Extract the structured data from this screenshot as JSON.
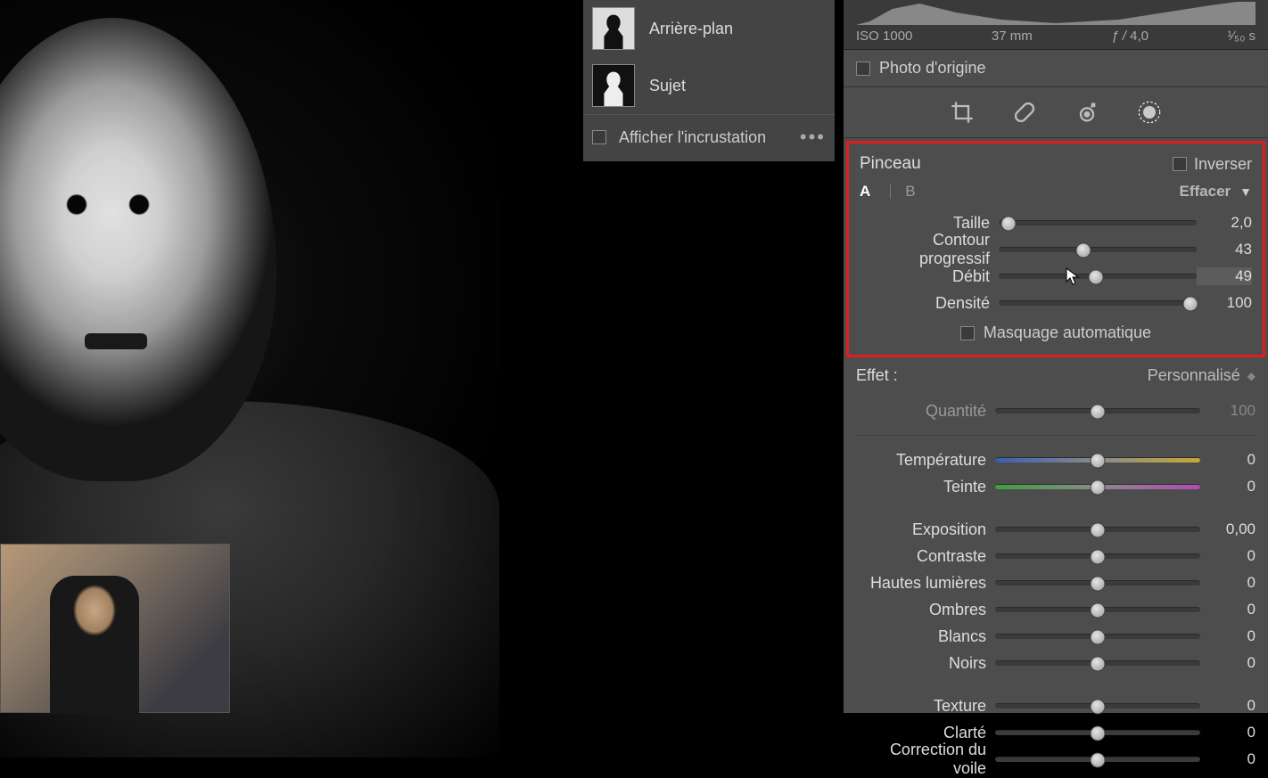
{
  "masks": {
    "background_label": "Arrière-plan",
    "subject_label": "Sujet"
  },
  "overlay": {
    "label": "Afficher l'incrustation"
  },
  "histogram": {
    "iso": "ISO 1000",
    "focal": "37 mm",
    "aperture_prefix": "ƒ / ",
    "aperture_val": "4,0",
    "shutter": "¹⁄₅₀ s"
  },
  "origin_label": "Photo d'origine",
  "brush": {
    "title": "Pinceau",
    "invert": "Inverser",
    "tab_a": "A",
    "tab_b": "B",
    "erase": "Effacer",
    "sliders": {
      "size": {
        "label": "Taille",
        "value": "2,0",
        "pos": 5
      },
      "feather": {
        "label": "Contour progressif",
        "value": "43",
        "pos": 43
      },
      "flow": {
        "label": "Débit",
        "value": "49",
        "pos": 49
      },
      "density": {
        "label": "Densité",
        "value": "100",
        "pos": 97
      }
    },
    "automask": "Masquage automatique"
  },
  "effect": {
    "label": "Effet :",
    "value": "Personnalisé"
  },
  "amount": {
    "label": "Quantité",
    "value": "100",
    "pos": 50
  },
  "adjust": {
    "temperature": {
      "label": "Température",
      "value": "0",
      "pos": 50
    },
    "tint": {
      "label": "Teinte",
      "value": "0",
      "pos": 50
    },
    "exposure": {
      "label": "Exposition",
      "value": "0,00",
      "pos": 50
    },
    "contrast": {
      "label": "Contraste",
      "value": "0",
      "pos": 50
    },
    "highlights": {
      "label": "Hautes lumières",
      "value": "0",
      "pos": 50
    },
    "shadows": {
      "label": "Ombres",
      "value": "0",
      "pos": 50
    },
    "whites": {
      "label": "Blancs",
      "value": "0",
      "pos": 50
    },
    "blacks": {
      "label": "Noirs",
      "value": "0",
      "pos": 50
    },
    "texture": {
      "label": "Texture",
      "value": "0",
      "pos": 50
    },
    "clarity": {
      "label": "Clarté",
      "value": "0",
      "pos": 50
    },
    "dehaze": {
      "label": "Correction du voile",
      "value": "0",
      "pos": 50
    }
  }
}
